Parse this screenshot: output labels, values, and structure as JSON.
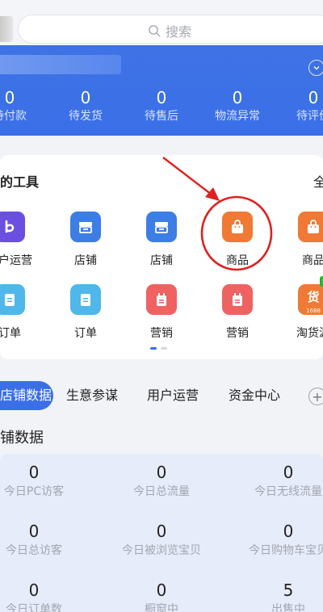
{
  "search": {
    "placeholder": "搜索"
  },
  "banner": {
    "stats": [
      {
        "value": "0",
        "label": "待付款"
      },
      {
        "value": "0",
        "label": "待发货"
      },
      {
        "value": "0",
        "label": "待售后"
      },
      {
        "value": "0",
        "label": "物流异常"
      },
      {
        "value": "0",
        "label": "待评价"
      }
    ]
  },
  "tools": {
    "title": "我的工具",
    "all_label": "全",
    "row1": [
      {
        "label": "用户运营",
        "icon": "user-ops-icon",
        "color": "#6b4fe0"
      },
      {
        "label": "店铺",
        "icon": "store-icon",
        "color": "#3d7ee4"
      },
      {
        "label": "店铺",
        "icon": "store-icon",
        "color": "#3d7ee4"
      },
      {
        "label": "商品",
        "icon": "shopping-bag-icon",
        "color": "#f07a35"
      },
      {
        "label": "商品",
        "icon": "shopping-bag-icon",
        "color": "#f07a35"
      }
    ],
    "row2": [
      {
        "label": "订单",
        "icon": "order-icon",
        "color": "#4fb7ea"
      },
      {
        "label": "订单",
        "icon": "order-icon",
        "color": "#4fb7ea"
      },
      {
        "label": "营销",
        "icon": "marketing-icon",
        "color": "#f06262"
      },
      {
        "label": "营销",
        "icon": "marketing-icon",
        "color": "#f06262"
      },
      {
        "label": "淘货源",
        "icon": "sourcing-icon",
        "color": "#f07a35",
        "badge": "新·",
        "sub": "1688"
      }
    ]
  },
  "tabs": [
    "店铺数据",
    "生意参谋",
    "用户运营",
    "资金中心"
  ],
  "section_title": "店铺数据",
  "grid": [
    {
      "value": "0",
      "label": "今日PC访客"
    },
    {
      "value": "0",
      "label": "今日总流量"
    },
    {
      "value": "0",
      "label": "今日无线流量"
    },
    {
      "value": "0",
      "label": "今日总访客"
    },
    {
      "value": "0",
      "label": "今日被浏览宝贝"
    },
    {
      "value": "0",
      "label": "今日购物车宝贝"
    },
    {
      "value": "0",
      "label": "今日订单数"
    },
    {
      "value": "0",
      "label": "橱窗中"
    },
    {
      "value": "5",
      "label": "出售中"
    }
  ],
  "colors": {
    "accent": "#3a6fe8",
    "annotation": "#e02020"
  }
}
